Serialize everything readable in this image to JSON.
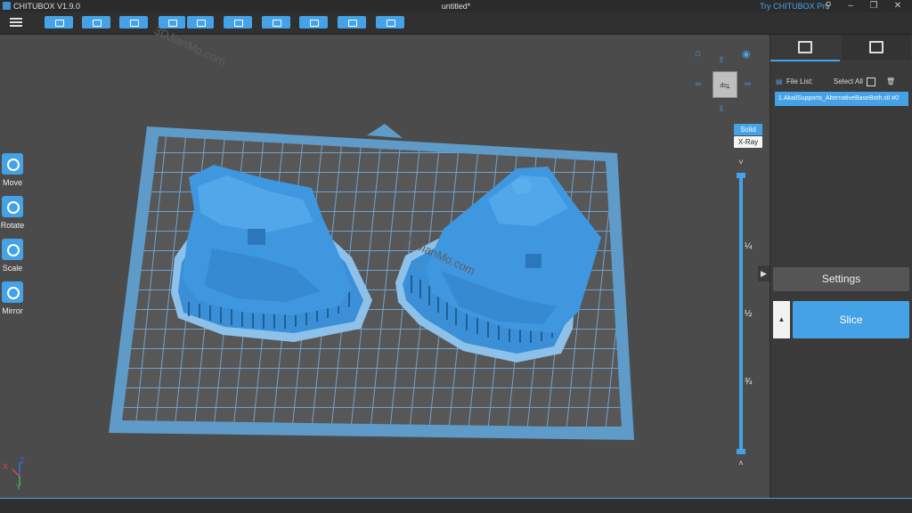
{
  "window": {
    "app_name": "CHITUBOX V1.9.0",
    "doc_title": "untitled*",
    "try_pro": "Try CHITUBOX Pro"
  },
  "left_tools": [
    "Move",
    "Rotate",
    "Scale",
    "Mirror"
  ],
  "view_modes": {
    "solid": "Solid",
    "xray": "X-Ray"
  },
  "view_cube_face": "Top",
  "slider_ticks": [
    "¼",
    "½",
    "¾"
  ],
  "file_panel": {
    "label": "File List:",
    "select_all": "Select All",
    "files": [
      "1.AkailSupports_AlternativeBaseBoth.stl #0"
    ]
  },
  "buttons": {
    "settings": "Settings",
    "slice": "Slice"
  },
  "axis_labels": {
    "x": "X",
    "y": "Y",
    "z": "Z"
  },
  "watermark": "3DJianMo.com",
  "colors": {
    "accent": "#45a2e6",
    "model": "#3f97e0",
    "plate": "#5f9bc9"
  }
}
